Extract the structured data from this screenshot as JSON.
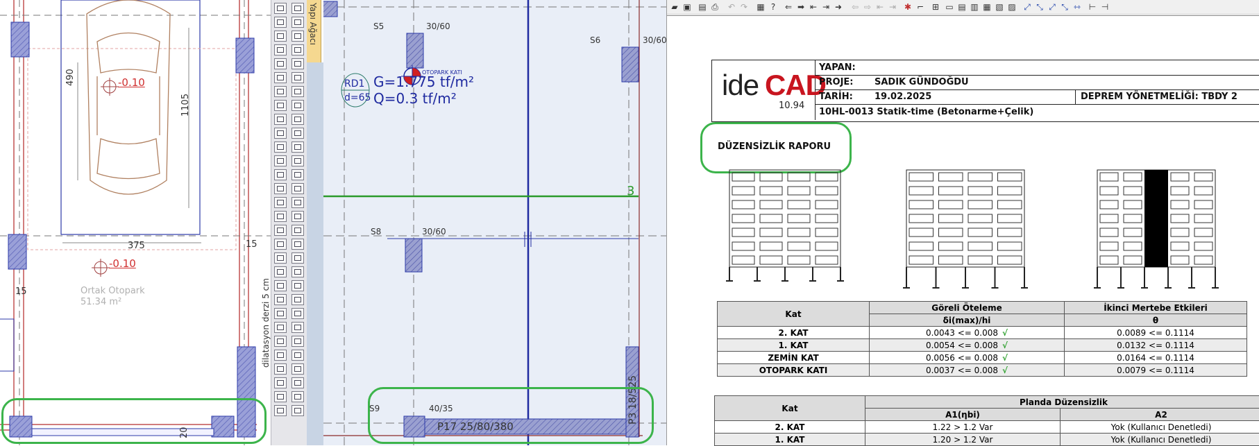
{
  "cad_left": {
    "dim_490": "490",
    "dim_1105": "1105",
    "dim_375": "375",
    "dim_15_right": "15",
    "dim_15_left": "15",
    "dim_20": "20",
    "elev_1": "-0.10",
    "elev_2": "-0.10",
    "room_name": "Ortak Otopark",
    "room_area": "51.34 m²",
    "dilatation_label": "dilatasyon derzi 5 cm"
  },
  "toolbar": {
    "yap_agaci_label": "Yapı Ağacı"
  },
  "cad_mid": {
    "col_s5": "S5",
    "col_s5_size": "30/60",
    "col_s6": "S6",
    "col_s6_size": "30/60",
    "col_s8": "S8",
    "col_s8_size": "30/60",
    "col_s9": "S9",
    "col_s9_size": "40/35",
    "slab_id": "RD1",
    "slab_d": "d=65",
    "load_g": "G=1.775 tf/m²",
    "load_q": "Q=0.3 tf/m²",
    "floor_label": "OTOPARK KATI",
    "axis_3": "3",
    "beam_p17": "P17 25/80/380",
    "beam_p3": "P3 18/525"
  },
  "report": {
    "logo_ide": "ide",
    "logo_cad": "CAD",
    "logo_version": "10.94",
    "yapan_label": "YAPAN:",
    "yapan_value": "",
    "proje_label": "PROJE:",
    "proje_value": "SADIK GÜNDOĞDU",
    "tarih_label": "TARİH:",
    "tarih_value": "19.02.2025",
    "deprem_label": "DEPREM YÖNETMELİĞİ: TBDY 2",
    "software_line": "10HL-0013 Statik-time (Betonarme+Çelik)",
    "section_title": "DÜZENSİZLİK RAPORU",
    "table1": {
      "h_kat": "Kat",
      "h_goreli": "Göreli Öteleme",
      "h_goreli_sub": "δi(max)/hi",
      "h_ikinci": "İkinci Mertebe Etkileri",
      "h_ikinci_sub": "θ",
      "rows": [
        {
          "kat": "2. KAT",
          "goreli": "0.0043 <= 0.008",
          "check": "√",
          "ikinci": "0.0089 <= 0.1114"
        },
        {
          "kat": "1. KAT",
          "goreli": "0.0054 <= 0.008",
          "check": "√",
          "ikinci": "0.0132 <= 0.1114"
        },
        {
          "kat": "ZEMİN KAT",
          "goreli": "0.0056 <= 0.008",
          "check": "√",
          "ikinci": "0.0164 <= 0.1114"
        },
        {
          "kat": "OTOPARK KATI",
          "goreli": "0.0037 <= 0.008",
          "check": "√",
          "ikinci": "0.0079 <= 0.1114"
        }
      ]
    },
    "table2": {
      "h_kat": "Kat",
      "h_planda": "Planda Düzensizlik",
      "h_a1": "A1(ηbi)",
      "h_a2": "A2",
      "rows": [
        {
          "kat": "2. KAT",
          "a1": "1.22 > 1.2  Var",
          "a2": "Yok  (Kullanıcı Denetledi)"
        },
        {
          "kat": "1. KAT",
          "a1": "1.20 > 1.2  Var",
          "a2": "Yok  (Kullanıcı Denetledi)"
        }
      ]
    }
  }
}
